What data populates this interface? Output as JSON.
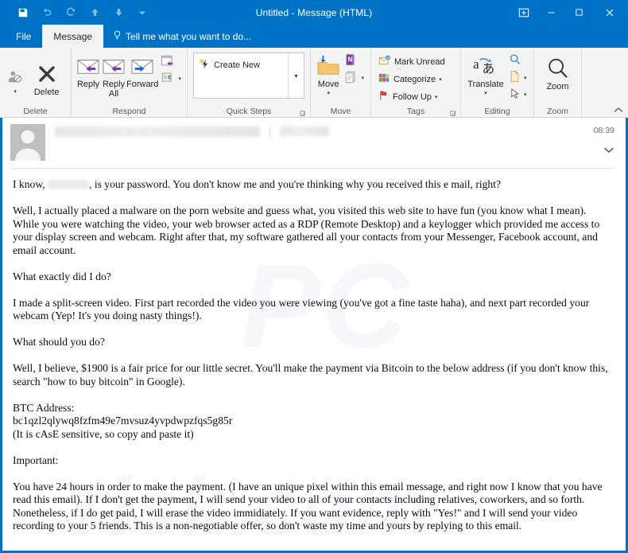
{
  "window": {
    "title": "Untitled  -  Message (HTML)",
    "accent_color": "#0072c6",
    "ribbon_bg": "#f4f4f4"
  },
  "quick_access": [
    {
      "name": "save-icon",
      "label": "Save"
    },
    {
      "name": "undo-icon",
      "label": "Undo"
    },
    {
      "name": "redo-icon",
      "label": "Redo"
    },
    {
      "name": "previous-item-icon",
      "label": "Previous Item"
    },
    {
      "name": "next-item-icon",
      "label": "Next Item"
    },
    {
      "name": "customize-quick-access-toolbar-icon",
      "label": "Customize Quick Access Toolbar"
    }
  ],
  "window_controls": [
    {
      "name": "restore-ribbon-icon",
      "label": "Ribbon Display Options"
    },
    {
      "name": "minimize-icon",
      "label": "Minimize"
    },
    {
      "name": "maximize-icon",
      "label": "Maximize"
    },
    {
      "name": "close-icon",
      "label": "Close"
    }
  ],
  "tabs": {
    "file": "File",
    "message": "Message",
    "tellme": "Tell me what you want to do...",
    "tellme_icon": "lightbulb-icon"
  },
  "ribbon": {
    "groups": [
      {
        "label": "Delete",
        "items": [
          {
            "label": "Delete",
            "icon": "delete-x-icon"
          },
          {
            "label": "Ignore",
            "icon": "ignore-person-icon"
          }
        ]
      },
      {
        "label": "Respond",
        "items": [
          {
            "label": "Reply",
            "icon": "reply-envelope-icon"
          },
          {
            "label": "Reply All",
            "icon": "reply-all-envelope-icon"
          },
          {
            "label": "Forward",
            "icon": "forward-envelope-icon"
          },
          {
            "label": "Meeting",
            "icon": "meeting-calendar-icon"
          },
          {
            "label": "More",
            "icon": "more-respond-icon"
          }
        ]
      },
      {
        "label": "Quick Steps",
        "items": [
          {
            "label": "Create New",
            "icon": "quick-step-lightning-icon"
          }
        ],
        "has_dialog_launcher": true
      },
      {
        "label": "Move",
        "items": [
          {
            "label": "Move",
            "icon": "move-folder-icon"
          },
          {
            "label": "OneNote",
            "icon": "onenote-icon"
          },
          {
            "label": "Rules",
            "icon": "rules-page-icon"
          }
        ]
      },
      {
        "label": "Tags",
        "items": [
          {
            "label": "Mark Unread",
            "icon": "mark-unread-icon"
          },
          {
            "label": "Categorize",
            "icon": "categorize-icon"
          },
          {
            "label": "Follow Up",
            "icon": "follow-up-flag-icon"
          }
        ],
        "has_dialog_launcher": true
      },
      {
        "label": "Editing",
        "items": [
          {
            "label": "Translate",
            "icon": "translate-icon"
          },
          {
            "label": "Find",
            "icon": "find-magnifier-icon"
          },
          {
            "label": "Related",
            "icon": "related-page-icon"
          },
          {
            "label": "Select",
            "icon": "select-pointer-icon"
          }
        ]
      },
      {
        "label": "Zoom",
        "items": [
          {
            "label": "Zoom",
            "icon": "zoom-magnifier-icon"
          }
        ]
      }
    ],
    "collapse_label": "Collapse the Ribbon",
    "collapse_icon": "chevron-up-icon"
  },
  "message_header": {
    "avatar_icon": "contact-avatar-icon",
    "sender_redacted": true,
    "recipient_redacted": true,
    "timestamp": "08:39",
    "expand_icon": "chevron-down-icon"
  },
  "message_body": {
    "paragraphs": [
      {
        "id": "p1",
        "parts": [
          {
            "type": "text",
            "value": "I know, "
          },
          {
            "type": "redacted"
          },
          {
            "type": "text",
            "value": ", is your password. You don't know me and you're thinking why you received this e mail, right?"
          }
        ]
      },
      {
        "id": "p2",
        "text": "Well, I actually placed a malware on the porn website and guess what, you visited this web site to have fun (you know what I mean). While you were watching the video, your web browser acted as a RDP (Remote Desktop) and a keylogger which provided me access to your display screen and webcam. Right after that, my software gathered all your contacts from your Messenger, Facebook account, and email account."
      },
      {
        "id": "p3",
        "text": "What exactly did I do?"
      },
      {
        "id": "p4",
        "text": "I made a split-screen video. First part recorded the video you were viewing (you've got a fine taste haha), and next part recorded your webcam (Yep! It's you doing nasty things!)."
      },
      {
        "id": "p5",
        "text": "What should you do?"
      },
      {
        "id": "p6",
        "text": "Well, I believe, $1900 is a fair price for our little secret. You'll make the payment via Bitcoin to the below address (if you don't know this, search \"how to buy bitcoin\" in Google)."
      },
      {
        "id": "p7_label",
        "text": "BTC Address:"
      },
      {
        "id": "p7_address",
        "text": "bc1qzl2qlywq8fzfm49e7mvsuz4yvpdwpzfqs5g85r"
      },
      {
        "id": "p7_note",
        "text": "(It is cAsE sensitive, so copy and paste it)"
      },
      {
        "id": "p8",
        "text": "Important:"
      },
      {
        "id": "p9",
        "text": "You have 24 hours in order to make the payment. (I have an unique pixel within this email message, and right now I know that you have read this email). If I don't get the payment, I will send your video to all of your contacts including relatives, coworkers, and so forth. Nonetheless, if I do get paid, I will erase the video immidiately. If you want evidence, reply with \"Yes!\" and I will send your video recording to your 5 friends. This is a non-negotiable offer, so don't waste my time and yours by replying to this email."
      }
    ],
    "ransom_amount": "$1900",
    "deadline_hours": "24",
    "btc_address": "bc1qzl2qlywq8fzfm49e7mvsuz4yvpdwpzfqs5g85r"
  },
  "watermark": {
    "line1": "PC",
    "line2": "risk.com",
    "line3": "PCrisk"
  }
}
